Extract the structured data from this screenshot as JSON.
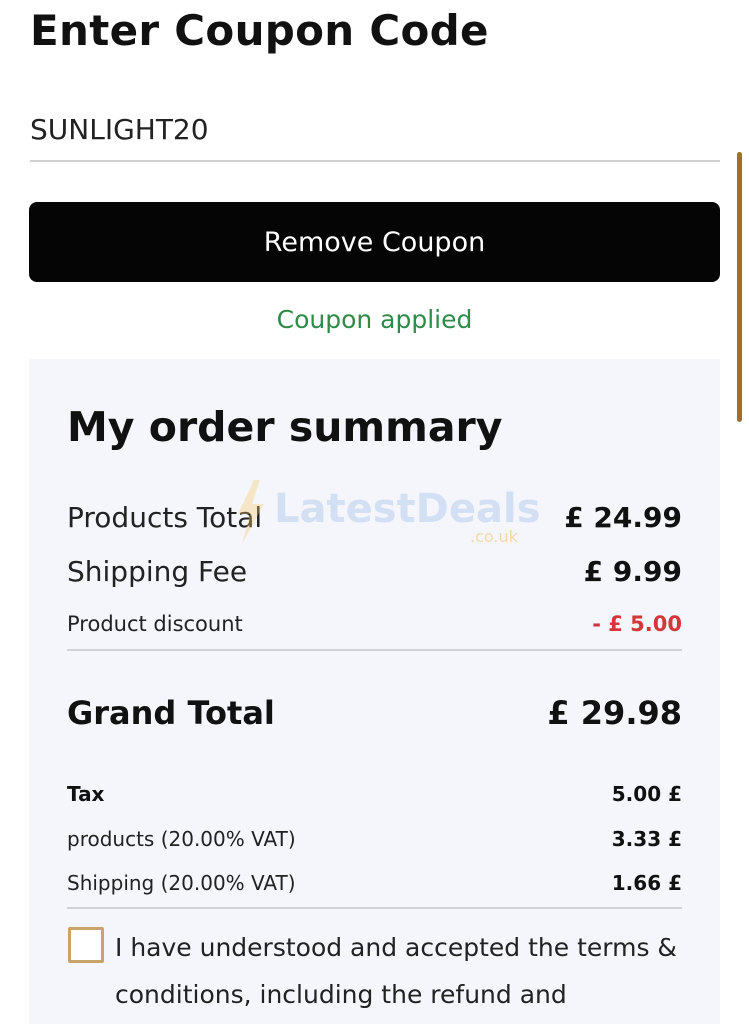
{
  "coupon": {
    "title": "Enter Coupon Code",
    "code_value": "SUNLIGHT20",
    "remove_button_label": "Remove Coupon",
    "status_text": "Coupon applied",
    "status_color": "#2e8b48"
  },
  "summary": {
    "title": "My order summary",
    "products_total": {
      "label": "Products Total",
      "value": "£ 24.99"
    },
    "shipping_fee": {
      "label": "Shipping Fee",
      "value": "£ 9.99"
    },
    "product_discount": {
      "label": "Product discount",
      "value": "- £ 5.00",
      "color": "#d2373a"
    },
    "grand_total": {
      "label": "Grand Total",
      "value": "£ 29.98"
    },
    "tax": {
      "label": "Tax",
      "value": "5.00 £"
    },
    "products_vat": {
      "label": "products (20.00% VAT)",
      "value": "3.33 £"
    },
    "shipping_vat": {
      "label": "Shipping (20.00% VAT)",
      "value": "1.66 £"
    }
  },
  "terms": {
    "text": "I have understood and accepted the terms & conditions, including the refund and",
    "checked": false
  },
  "watermark": {
    "brand": "LatestDeals",
    "suffix": ".co.uk"
  },
  "colors": {
    "button_bg": "#050505",
    "panel_bg": "#f4f6fb",
    "checkbox_border": "#c9a46a",
    "scrollbar": "#a86d1f"
  }
}
